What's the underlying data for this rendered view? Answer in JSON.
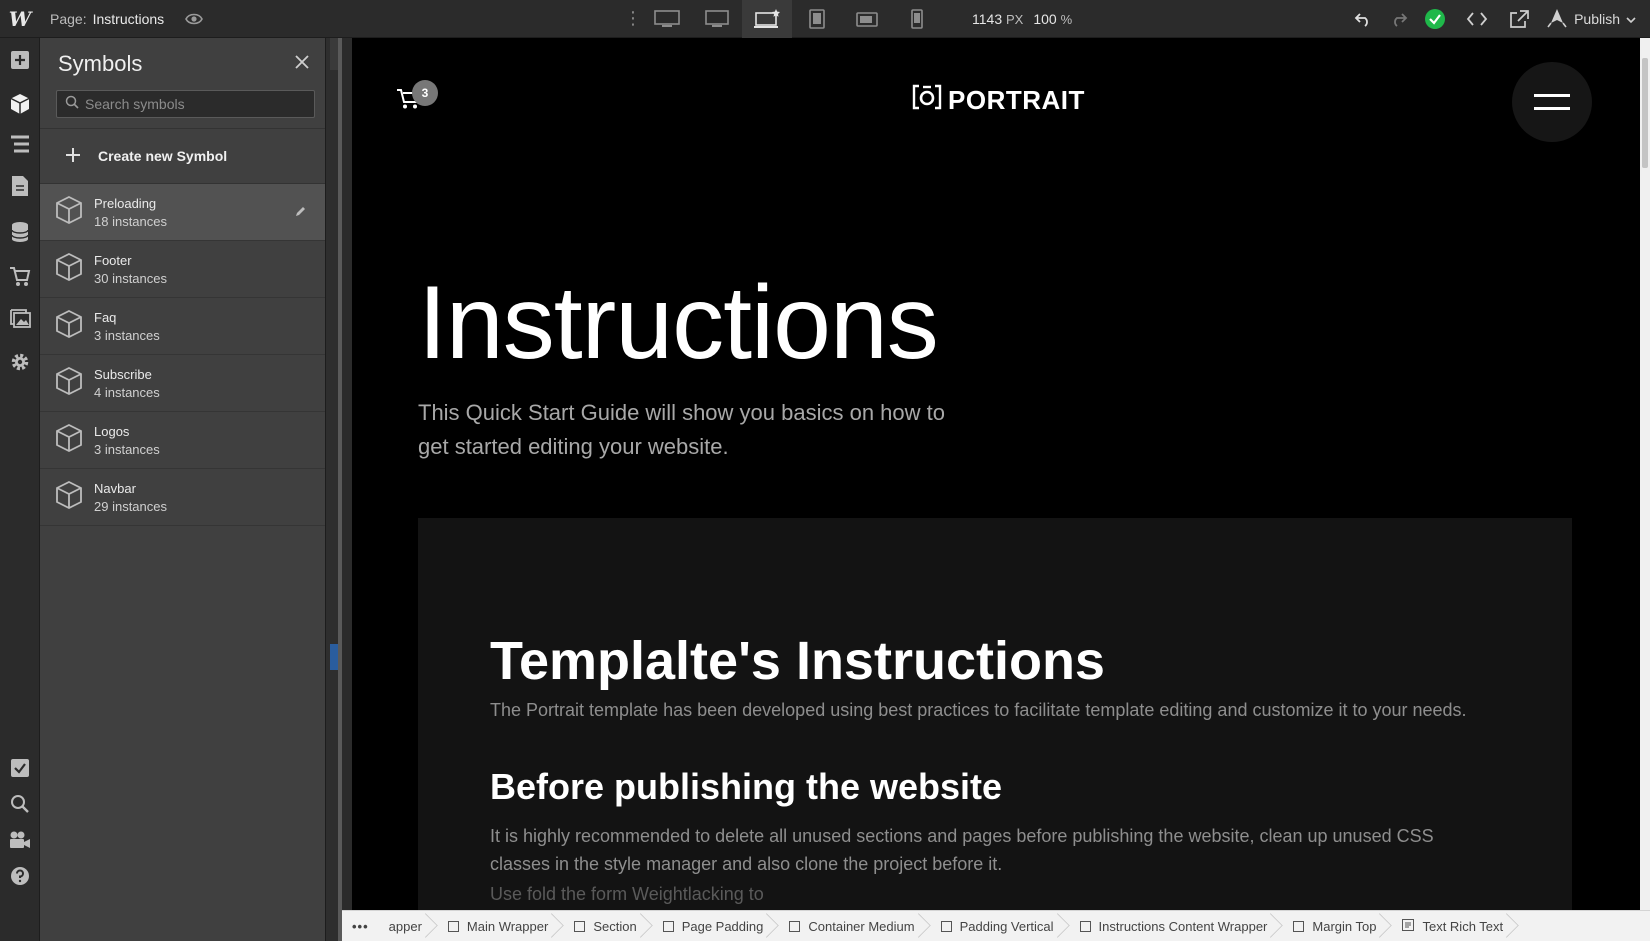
{
  "topbar": {
    "logo": "W",
    "page_label": "Page:",
    "page_name": "Instructions",
    "width_value": "1143",
    "width_unit": "PX",
    "zoom_value": "100",
    "zoom_unit": "%",
    "publish_label": "Publish",
    "status_color": "#1fb84a"
  },
  "panel": {
    "title": "Symbols",
    "search_placeholder": "Search symbols",
    "create_label": "Create new Symbol",
    "symbols": [
      {
        "name": "Preloading",
        "count": "18 instances"
      },
      {
        "name": "Footer",
        "count": "30 instances"
      },
      {
        "name": "Faq",
        "count": "3 instances"
      },
      {
        "name": "Subscribe",
        "count": "4 instances"
      },
      {
        "name": "Logos",
        "count": "3 instances"
      },
      {
        "name": "Navbar",
        "count": "29 instances"
      }
    ]
  },
  "canvas": {
    "cart_count": "3",
    "brand_name": "PORTRAIT",
    "hero_title": "Instructions",
    "hero_subtitle": "This Quick Start Guide will show you basics on how to get started editing your website.",
    "content_title": "Templalte's Instructions",
    "content_intro": "The Portrait template has been developed using best practices to facilitate template editing and customize it to your needs.",
    "section_title": "Before publishing the website",
    "section_text": "It is highly recommended to delete all unused sections and pages before publishing the website, clean up unused CSS classes in the style manager and also clone the project before it.",
    "partial_text": "Use fold the form Weightlacking to"
  },
  "breadcrumbs": {
    "more": "•••",
    "items": [
      "apper",
      "Main Wrapper",
      "Section",
      "Page Padding",
      "Container Medium",
      "Padding Vertical",
      "Instructions Content Wrapper",
      "Margin Top",
      "Text Rich Text"
    ]
  }
}
